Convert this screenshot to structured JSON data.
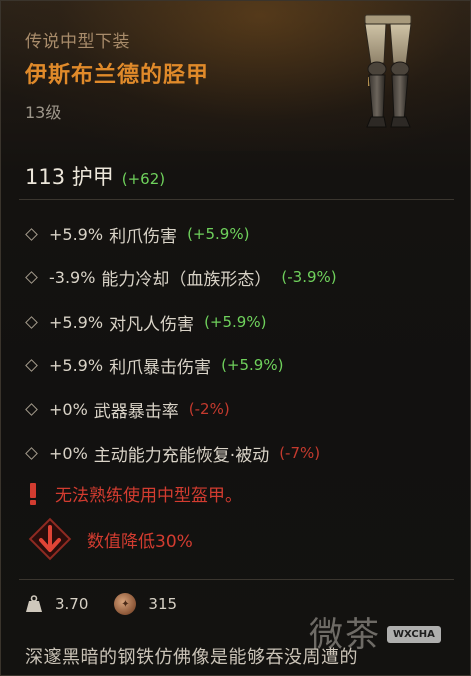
{
  "item": {
    "rarity_type": "传说中型下装",
    "name": "伊斯布兰德的胫甲",
    "level": "13级",
    "art_icon": "leg-armor-greaves-icon"
  },
  "armor": {
    "value": "113 护甲",
    "bonus": "(+62)"
  },
  "affixes": [
    {
      "value": "+5.9%",
      "name": "利爪伤害",
      "delta": "(+5.9%)",
      "delta_color": "#6fd15c"
    },
    {
      "value": "-3.9%",
      "name": "能力冷却（血族形态）",
      "delta": "(-3.9%)",
      "delta_color": "#6fd15c"
    },
    {
      "value": "+5.9%",
      "name": "对凡人伤害",
      "delta": "(+5.9%)",
      "delta_color": "#6fd15c"
    },
    {
      "value": "+5.9%",
      "name": "利爪暴击伤害",
      "delta": "(+5.9%)",
      "delta_color": "#6fd15c"
    },
    {
      "value": "+0%",
      "name": "武器暴击率",
      "delta": "(-2%)",
      "delta_color": "#c43a2e"
    },
    {
      "value": "+0%",
      "name": "主动能力充能恢复·被动",
      "delta": "(-7%)",
      "delta_color": "#c43a2e"
    }
  ],
  "warning": {
    "icon": "exclamation-icon",
    "text": "无法熟练使用中型盔甲。"
  },
  "reduction": {
    "icon": "down-arrow-icon",
    "text": "数值降低30%"
  },
  "stats": {
    "weight_icon": "weight-icon",
    "weight": "3.70",
    "coin_icon": "coin-icon",
    "value": "315"
  },
  "flavor_text": "深邃黑暗的钢铁仿佛像是能够吞没周遭的",
  "watermark": {
    "logo": "微茶",
    "tag": "WXCHA"
  },
  "colors": {
    "legendary_orange": "#e08a2a",
    "positive_green": "#6fd15c",
    "negative_red": "#c43a2e"
  }
}
